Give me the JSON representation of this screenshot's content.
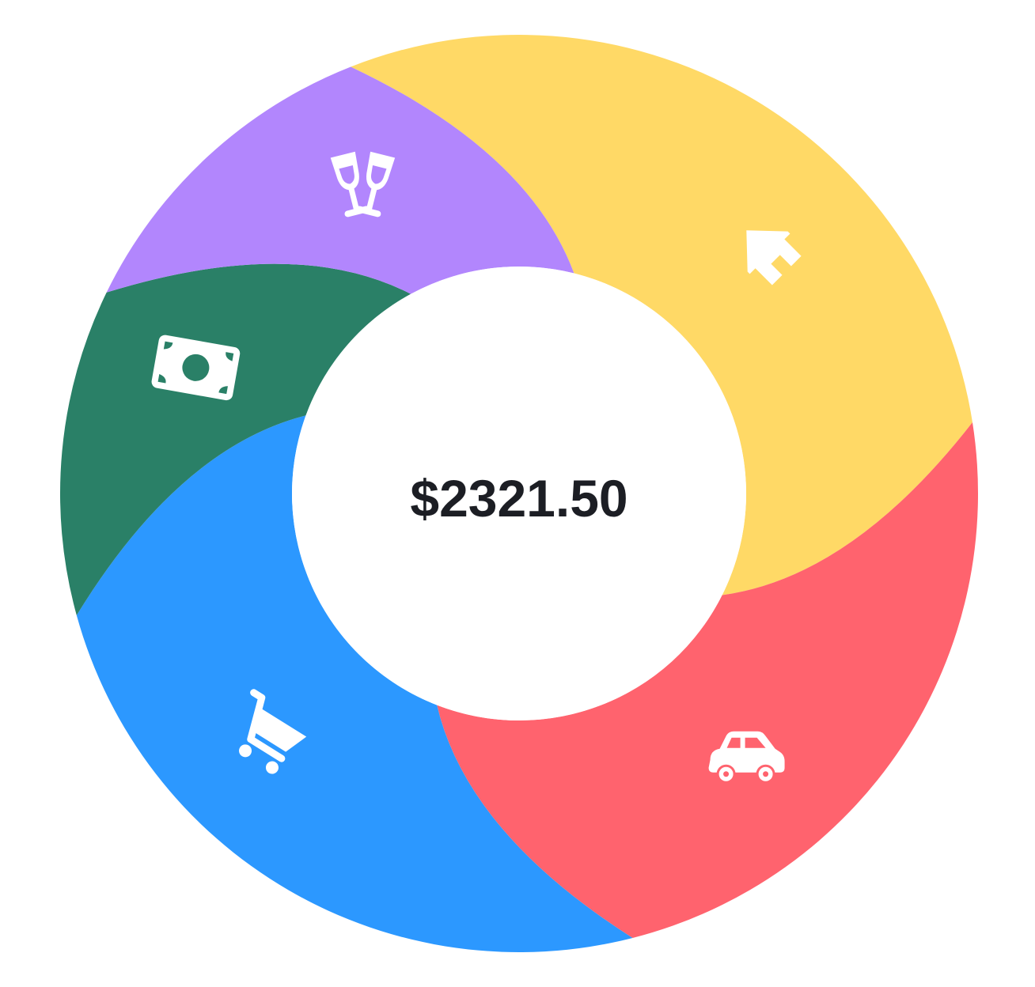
{
  "chart_data": {
    "type": "pie",
    "donut": true,
    "total_label": "$2321.50",
    "slices": [
      {
        "category": "housing",
        "icon": "house-icon",
        "color": "#FFD966",
        "value": 0.285
      },
      {
        "category": "transport",
        "icon": "car-icon",
        "color": "#FF636E",
        "value": 0.235
      },
      {
        "category": "shopping",
        "icon": "shopping-cart-icon",
        "color": "#2C98FF",
        "value": 0.247
      },
      {
        "category": "income",
        "icon": "cash-icon",
        "color": "#2A8067",
        "value": 0.115
      },
      {
        "category": "entertainment",
        "icon": "cheers-glasses-icon",
        "color": "#B286FD",
        "value": 0.118
      }
    ],
    "legend": "none",
    "grid": false
  }
}
